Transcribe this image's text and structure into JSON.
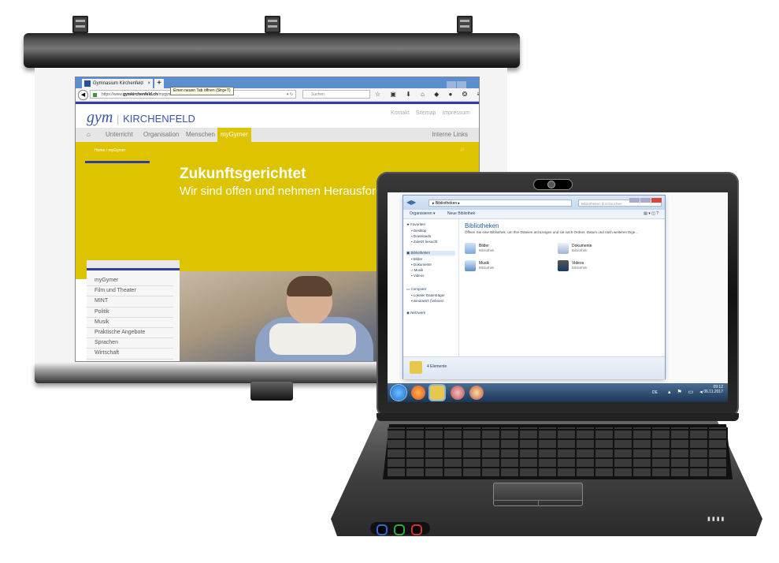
{
  "browser": {
    "tab_title": "Gymnasium Kirchenfeld",
    "tab_close": "×",
    "new_tab": "+",
    "tooltip": "Einen neuen Tab öffnen (Strg+T)",
    "url_prefix": "https://www.",
    "url_domain": "gymkirchenfeld.ch",
    "url_path": "/mygymer/",
    "search_placeholder": "Suchen",
    "toolbar_icons": "☆ ▣ ⬇ ⌂ ◆ ● ❂ ≡"
  },
  "site": {
    "logo_gym": "gym",
    "logo_kirchenfeld": "KIRCHENFELD",
    "top_links": [
      "Kontakt",
      "Sitemap",
      "Impressum"
    ],
    "menu": [
      "Unterricht",
      "Organisation",
      "Menschen",
      "myGymer"
    ],
    "menu_right": "Interne Links",
    "breadcrumb": "Home  /  myGymer",
    "hero_title": "Zukunftsgerichtet",
    "hero_subtitle": "Wir sind offen und nehmen Herausforderungen an.",
    "submenu": [
      "myGymer",
      "Film und Theater",
      "MINT",
      "Politik",
      "Musik",
      "Praktische Angebote",
      "Sprachen",
      "Wirtschaft"
    ]
  },
  "explorer": {
    "address": "▸ Bibliotheken ▸",
    "search_placeholder": "Bibliotheken durchsuchen",
    "organize": "Organisieren ▾",
    "new_library": "Neue Bibliothek",
    "sidebar": {
      "favorites": "Favoriten",
      "desktop": "Desktop",
      "downloads": "Downloads",
      "recent": "Zuletzt besucht",
      "libraries": "Bibliotheken",
      "pictures": "Bilder",
      "documents": "Dokumente",
      "music": "Musik",
      "videos": "Videos",
      "computer": "Computer",
      "local_disk": "Lokaler Datenträger",
      "network_drive": "windows7 (\\\\vboxsr",
      "network": "Netzwerk"
    },
    "heading": "Bibliotheken",
    "description": "Öffnen Sie eine Bibliothek, um Ihre Dateien anzuzeigen und sie nach Ordner, Datum und nach weiteren Eige...",
    "libraries": [
      {
        "name": "Bilder",
        "type": "Bibliothek"
      },
      {
        "name": "Dokumente",
        "type": "Bibliothek"
      },
      {
        "name": "Musik",
        "type": "Bibliothek"
      },
      {
        "name": "Videos",
        "type": "Bibliothek"
      }
    ],
    "status": "4 Elemente"
  },
  "taskbar": {
    "lang": "DE",
    "time": "09:12",
    "date": "06.11.2017"
  },
  "colors": {
    "brand_blue": "#2e3ea4",
    "brand_yellow": "#dec400",
    "win_accent": "#1e5fa6"
  }
}
